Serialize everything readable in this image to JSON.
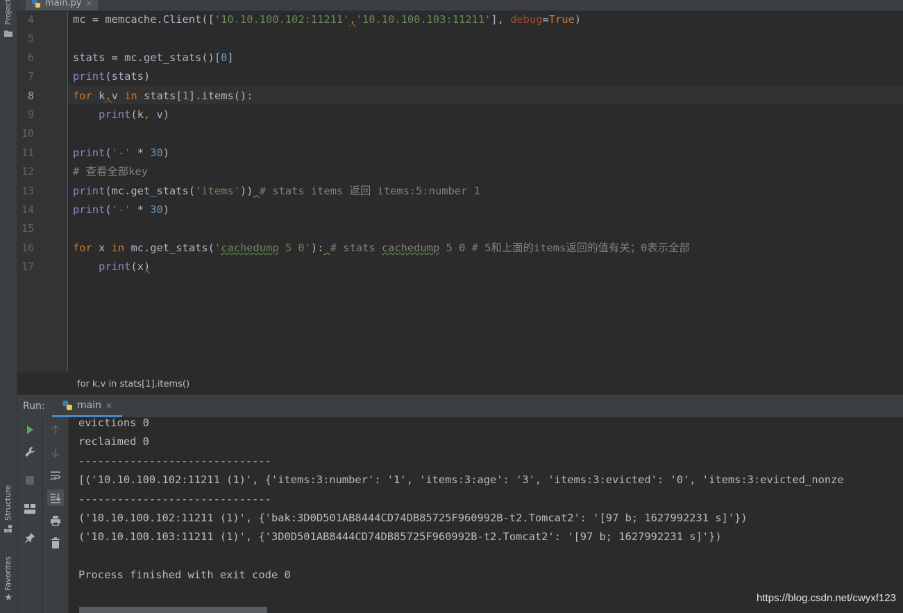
{
  "project_sidebar": {
    "project_label": "Project"
  },
  "bottom_sidebar": {
    "structure_label": "Structure",
    "favorites_label": "Favorites"
  },
  "editor_tab": {
    "filename": "main.py",
    "close": "×"
  },
  "editor": {
    "line_numbers": [
      "4",
      "5",
      "6",
      "7",
      "8",
      "9",
      "10",
      "11",
      "12",
      "13",
      "14",
      "15",
      "16",
      "17"
    ],
    "current_line": "8",
    "code_lines": [
      [
        {
          "t": "mc = memcache.Client(["
        },
        {
          "t": "'10.10.100.102:11211'",
          "c": "str"
        },
        {
          "t": ",",
          "c": "kw wavy"
        },
        {
          "t": "'10.10.100.103:11211'",
          "c": "str"
        },
        {
          "t": "], "
        },
        {
          "t": "debug",
          "c": "param"
        },
        {
          "t": "="
        },
        {
          "t": "True",
          "c": "kw"
        },
        {
          "t": ")"
        }
      ],
      [],
      [
        {
          "t": "stats = mc.get_stats()["
        },
        {
          "t": "0",
          "c": "num"
        },
        {
          "t": "]"
        }
      ],
      [
        {
          "t": "print",
          "c": "bi"
        },
        {
          "t": "(stats)"
        }
      ],
      [
        {
          "t": "for",
          "c": "kw"
        },
        {
          "t": " k"
        },
        {
          "t": ",",
          "c": "kw wavy"
        },
        {
          "t": "v "
        },
        {
          "t": "in",
          "c": "kw"
        },
        {
          "t": " stats["
        },
        {
          "t": "1",
          "c": "num"
        },
        {
          "t": "].items():"
        }
      ],
      [
        {
          "t": "    "
        },
        {
          "t": "print",
          "c": "bi"
        },
        {
          "t": "(k"
        },
        {
          "t": ",",
          "c": "kw"
        },
        {
          "t": " v)"
        }
      ],
      [],
      [
        {
          "t": "print",
          "c": "bi"
        },
        {
          "t": "("
        },
        {
          "t": "'-'",
          "c": "str"
        },
        {
          "t": " * "
        },
        {
          "t": "30",
          "c": "num"
        },
        {
          "t": ")"
        }
      ],
      [
        {
          "t": "# 查看全部key",
          "c": "cm"
        }
      ],
      [
        {
          "t": "print",
          "c": "bi"
        },
        {
          "t": "(mc.get_stats("
        },
        {
          "t": "'items'",
          "c": "str"
        },
        {
          "t": "))"
        },
        {
          "t": " ",
          "c": "wavy"
        },
        {
          "t": "# stats items 返回 items:5:number 1",
          "c": "cm"
        }
      ],
      [
        {
          "t": "print",
          "c": "bi"
        },
        {
          "t": "("
        },
        {
          "t": "'-'",
          "c": "str"
        },
        {
          "t": " * "
        },
        {
          "t": "30",
          "c": "num"
        },
        {
          "t": ")"
        }
      ],
      [],
      [
        {
          "t": "for",
          "c": "kw"
        },
        {
          "t": " x "
        },
        {
          "t": "in",
          "c": "kw"
        },
        {
          "t": " mc.get_stats("
        },
        {
          "t": "'",
          "c": "str"
        },
        {
          "t": "cachedump",
          "c": "str wavyg"
        },
        {
          "t": " 5 0'",
          "c": "str"
        },
        {
          "t": "):"
        },
        {
          "t": " ",
          "c": "wavy"
        },
        {
          "t": "# stats ",
          "c": "cm"
        },
        {
          "t": "cachedump",
          "c": "cm wavyg"
        },
        {
          "t": " 5 0 # 5和上面的items返回的值有关；0表示全部",
          "c": "cm"
        }
      ],
      [
        {
          "t": "    "
        },
        {
          "t": "print",
          "c": "bi"
        },
        {
          "t": "(x"
        },
        {
          "t": ")",
          "c": "wavy"
        }
      ]
    ]
  },
  "breadcrumb": {
    "text": "for k,v in stats[1].items()"
  },
  "run_panel": {
    "label": "Run:",
    "tab_name": "main",
    "tab_close": "×",
    "output_lines": [
      "evictions 0",
      "reclaimed 0",
      "------------------------------",
      "[('10.10.100.102:11211 (1)', {'items:3:number': '1', 'items:3:age': '3', 'items:3:evicted': '0', 'items:3:evicted_nonze",
      "------------------------------",
      "('10.10.100.102:11211 (1)', {'bak:3D0D501AB8444CD74DB85725F960992B-t2.Tomcat2': '[97 b; 1627992231 s]'})",
      "('10.10.100.103:11211 (1)', {'3D0D501AB8444CD74DB85725F960992B-t2.Tomcat2': '[97 b; 1627992231 s]'})",
      "",
      "Process finished with exit code 0"
    ]
  },
  "watermark": "https://blog.csdn.net/cwyxf123",
  "colors": {
    "keyword": "#cc7832",
    "string": "#6a8759",
    "number": "#6897bb",
    "builtin": "#8888c6",
    "comment": "#808080",
    "run_green": "#59a869"
  }
}
